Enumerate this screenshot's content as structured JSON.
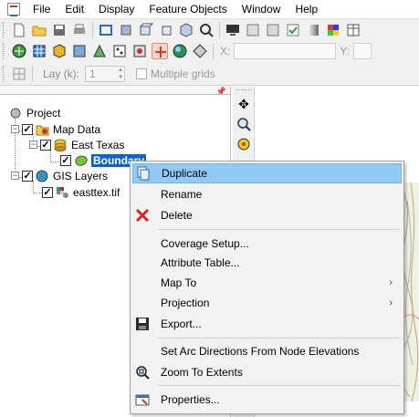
{
  "menubar": {
    "items": [
      "File",
      "Edit",
      "Display",
      "Feature Objects",
      "Window",
      "Help"
    ]
  },
  "toolbar_coords": {
    "x_label": "X:",
    "y_label": "Y:"
  },
  "grid_toolbar": {
    "lay_label": "Lay (k):",
    "lay_value": "1",
    "multiple_grids_label": "Multiple grids"
  },
  "tree": {
    "project": "Project",
    "map_data": "Map Data",
    "east_texas": "East Texas",
    "boundary": "Boundary",
    "gis_layers": "GIS Layers",
    "easttex": "easttex.tif"
  },
  "context_menu": {
    "items": [
      {
        "label": "Duplicate",
        "icon": "duplicate-icon",
        "highlighted": true
      },
      {
        "label": "Rename",
        "icon": ""
      },
      {
        "label": "Delete",
        "icon": "delete-x-icon"
      },
      {
        "label": "Coverage Setup...",
        "icon": ""
      },
      {
        "label": "Attribute Table...",
        "icon": ""
      },
      {
        "label": "Map To",
        "icon": "",
        "submenu": true
      },
      {
        "label": "Projection",
        "icon": "",
        "submenu": true
      },
      {
        "label": "Export...",
        "icon": "save-icon"
      },
      {
        "label": "Set Arc Directions From Node Elevations",
        "icon": ""
      },
      {
        "label": "Zoom To Extents",
        "icon": "zoom-extents-icon"
      },
      {
        "label": "Properties...",
        "icon": "properties-icon"
      }
    ],
    "submenu_arrow": "›"
  },
  "colors": {
    "selection_blue": "#0b63c8",
    "menu_highlight": "#91c9f7",
    "delete_red": "#e02020"
  }
}
